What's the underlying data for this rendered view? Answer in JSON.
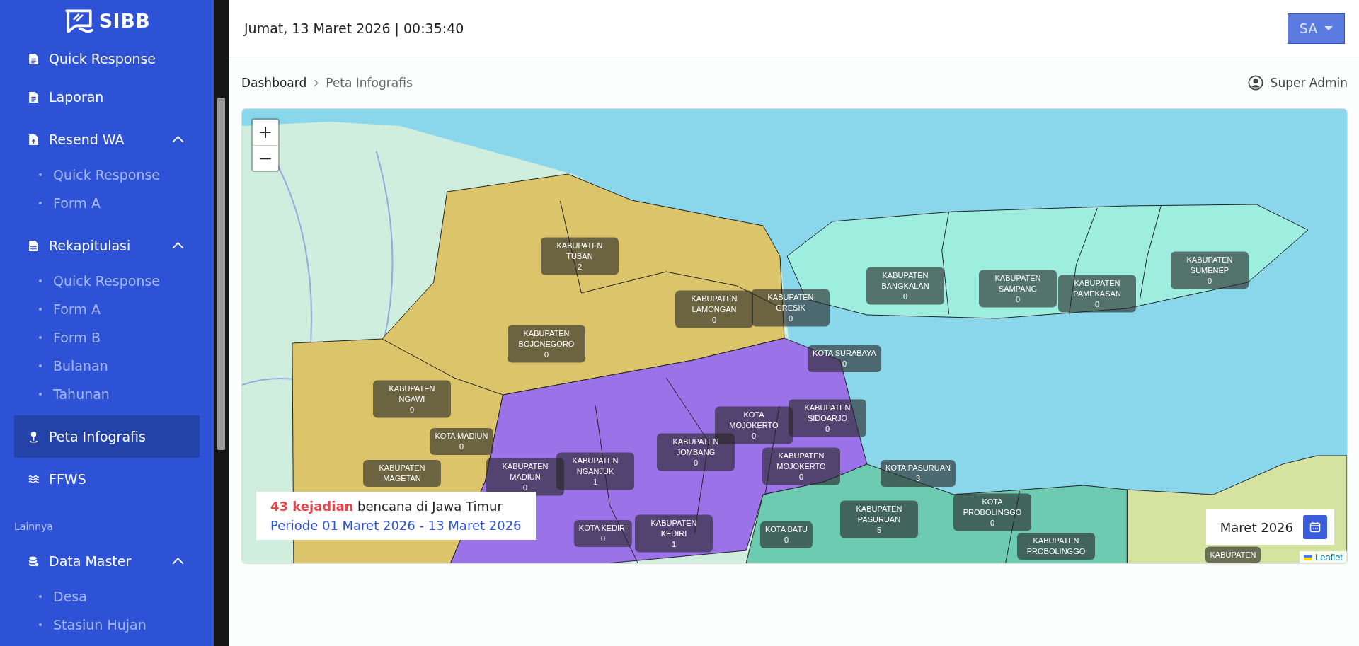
{
  "sidebar": {
    "logo": "SIBB",
    "items": [
      {
        "kind": "link",
        "label": "Quick Response",
        "selected": false
      },
      {
        "kind": "link",
        "label": "Laporan",
        "selected": false
      },
      {
        "kind": "group",
        "label": "Resend WA",
        "expanded": true,
        "children": [
          {
            "label": "Quick Response",
            "selected": false
          },
          {
            "label": "Form A",
            "selected": false
          }
        ]
      },
      {
        "kind": "group",
        "label": "Rekapitulasi",
        "expanded": true,
        "children": [
          {
            "label": "Quick Response",
            "selected": false
          },
          {
            "label": "Form A",
            "selected": false
          },
          {
            "label": "Form B",
            "selected": false
          },
          {
            "label": "Bulanan",
            "selected": false
          },
          {
            "label": "Tahunan",
            "selected": false
          }
        ]
      },
      {
        "kind": "link",
        "label": "Peta Infografis",
        "selected": true
      },
      {
        "kind": "link",
        "label": "FFWS",
        "selected": false
      },
      {
        "kind": "heading",
        "label": "Lainnya"
      },
      {
        "kind": "group",
        "label": "Data Master",
        "expanded": true,
        "children": [
          {
            "label": "Desa",
            "selected": false
          },
          {
            "label": "Stasiun Hujan",
            "selected": false
          }
        ]
      }
    ]
  },
  "header": {
    "datetime": "Jumat, 13 Maret 2026 | 00:35:40",
    "user_button": "SA"
  },
  "breadcrumb": [
    "Dashboard",
    "Peta Infografis"
  ],
  "user": "Super Admin",
  "map": {
    "zoom_in": "+",
    "zoom_out": "−",
    "regions": [
      {
        "name": "KABUPATEN TUBAN",
        "value": "2"
      },
      {
        "name": "KABUPATEN BOJONEGORO",
        "value": "0"
      },
      {
        "name": "KABUPATEN LAMONGAN",
        "value": "0"
      },
      {
        "name": "KABUPATEN GRESIK",
        "value": "0"
      },
      {
        "name": "KABUPATEN BANGKALAN",
        "value": "0"
      },
      {
        "name": "KABUPATEN SAMPANG",
        "value": "0"
      },
      {
        "name": "KABUPATEN PAMEKASAN",
        "value": "0"
      },
      {
        "name": "KABUPATEN SUMENEP",
        "value": "0"
      },
      {
        "name": "KOTA SURABAYA",
        "value": "0"
      },
      {
        "name": "KABUPATEN NGAWI",
        "value": "0"
      },
      {
        "name": "KABUPATEN SIDOARJO",
        "value": "0"
      },
      {
        "name": "KOTA MOJOKERTO",
        "value": "0"
      },
      {
        "name": "KABUPATEN MOJOKERTO",
        "value": "0"
      },
      {
        "name": "KABUPATEN JOMBANG",
        "value": "0"
      },
      {
        "name": "KOTA MADIUN",
        "value": "0"
      },
      {
        "name": "KABUPATEN MAGETAN"
      },
      {
        "name": "KABUPATEN MADIUN",
        "value": "0"
      },
      {
        "name": "KABUPATEN NGANJUK",
        "value": "1"
      },
      {
        "name": "KOTA PASURUAN",
        "value": "3"
      },
      {
        "name": "KABUPATEN PASURUAN",
        "value": "5"
      },
      {
        "name": "KOTA KEDIRI",
        "value": "0"
      },
      {
        "name": "KABUPATEN KEDIRI",
        "value": "1"
      },
      {
        "name": "KOTA BATU",
        "value": "0"
      },
      {
        "name": "KOTA PROBOLINGGO",
        "value": "0"
      },
      {
        "name": "KABUPATEN PROBOLINGGO"
      },
      {
        "name": "KABUPATEN"
      }
    ],
    "summary": {
      "count": "43 kejadian",
      "text": "bencana di Jawa Timur",
      "period": "Periode 01 Maret 2026 - 13 Maret 2026"
    },
    "month": "Maret 2026",
    "attribution": "Leaflet"
  }
}
